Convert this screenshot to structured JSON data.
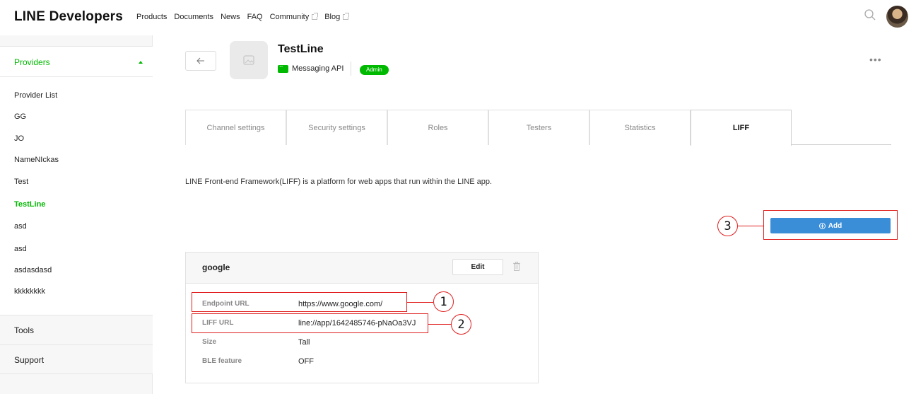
{
  "header": {
    "brand_line": "LINE",
    "brand_rest": "Developers",
    "nav": [
      {
        "label": "Products",
        "external": false
      },
      {
        "label": "Documents",
        "external": false
      },
      {
        "label": "News",
        "external": false
      },
      {
        "label": "FAQ",
        "external": false
      },
      {
        "label": "Community",
        "external": true
      },
      {
        "label": "Blog",
        "external": true
      }
    ],
    "search_icon": "search-icon"
  },
  "sidebar": {
    "providers_label": "Providers",
    "providers": [
      {
        "label": "Provider List",
        "active": false
      },
      {
        "label": "GG",
        "active": false
      },
      {
        "label": "JO",
        "active": false
      },
      {
        "label": "NameNIckas",
        "active": false
      },
      {
        "label": "Test",
        "active": false
      },
      {
        "label": "TestLine",
        "active": true
      },
      {
        "label": "asd",
        "active": false
      },
      {
        "label": "asd",
        "active": false
      },
      {
        "label": "asdasdasd",
        "active": false
      },
      {
        "label": "kkkkkkkk",
        "active": false
      }
    ],
    "tools_label": "Tools",
    "support_label": "Support"
  },
  "channel": {
    "title": "TestLine",
    "type_label": "Messaging API",
    "role_badge": "Admin"
  },
  "tabs": [
    {
      "label": "Channel settings",
      "active": false
    },
    {
      "label": "Security settings",
      "active": false
    },
    {
      "label": "Roles",
      "active": false
    },
    {
      "label": "Testers",
      "active": false
    },
    {
      "label": "Statistics",
      "active": false
    },
    {
      "label": "LIFF",
      "active": true
    }
  ],
  "liff": {
    "description": "LINE Front-end Framework(LIFF) is a platform for web apps that run within the LINE app.",
    "add_label": "Add",
    "app": {
      "name": "google",
      "edit_label": "Edit",
      "rows": [
        {
          "label": "Endpoint URL",
          "value": "https://www.google.com/"
        },
        {
          "label": "LIFF URL",
          "value": "line://app/1642485746-pNaOa3VJ"
        },
        {
          "label": "Size",
          "value": "Tall"
        },
        {
          "label": "BLE feature",
          "value": "OFF"
        }
      ]
    }
  },
  "annotations": [
    "1",
    "2",
    "3"
  ],
  "colors": {
    "accent": "#00b900",
    "button_blue": "#3a8ed8",
    "annotation": "#e02020"
  }
}
